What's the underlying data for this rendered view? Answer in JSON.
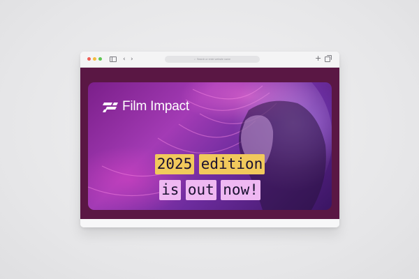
{
  "browser": {
    "address_placeholder": "Search or enter website name",
    "search_icon": "magnifier-icon",
    "back_icon": "‹",
    "forward_icon": "›",
    "new_tab_icon": "+"
  },
  "hero": {
    "brand": "Film Impact",
    "headline_line1": [
      "2025",
      "edition"
    ],
    "headline_line2": [
      "is",
      "out",
      "now!"
    ]
  },
  "colors": {
    "page_background": "#5a1744",
    "chip_yellow": "#f1c95c",
    "chip_pink": "#efb8f2"
  }
}
